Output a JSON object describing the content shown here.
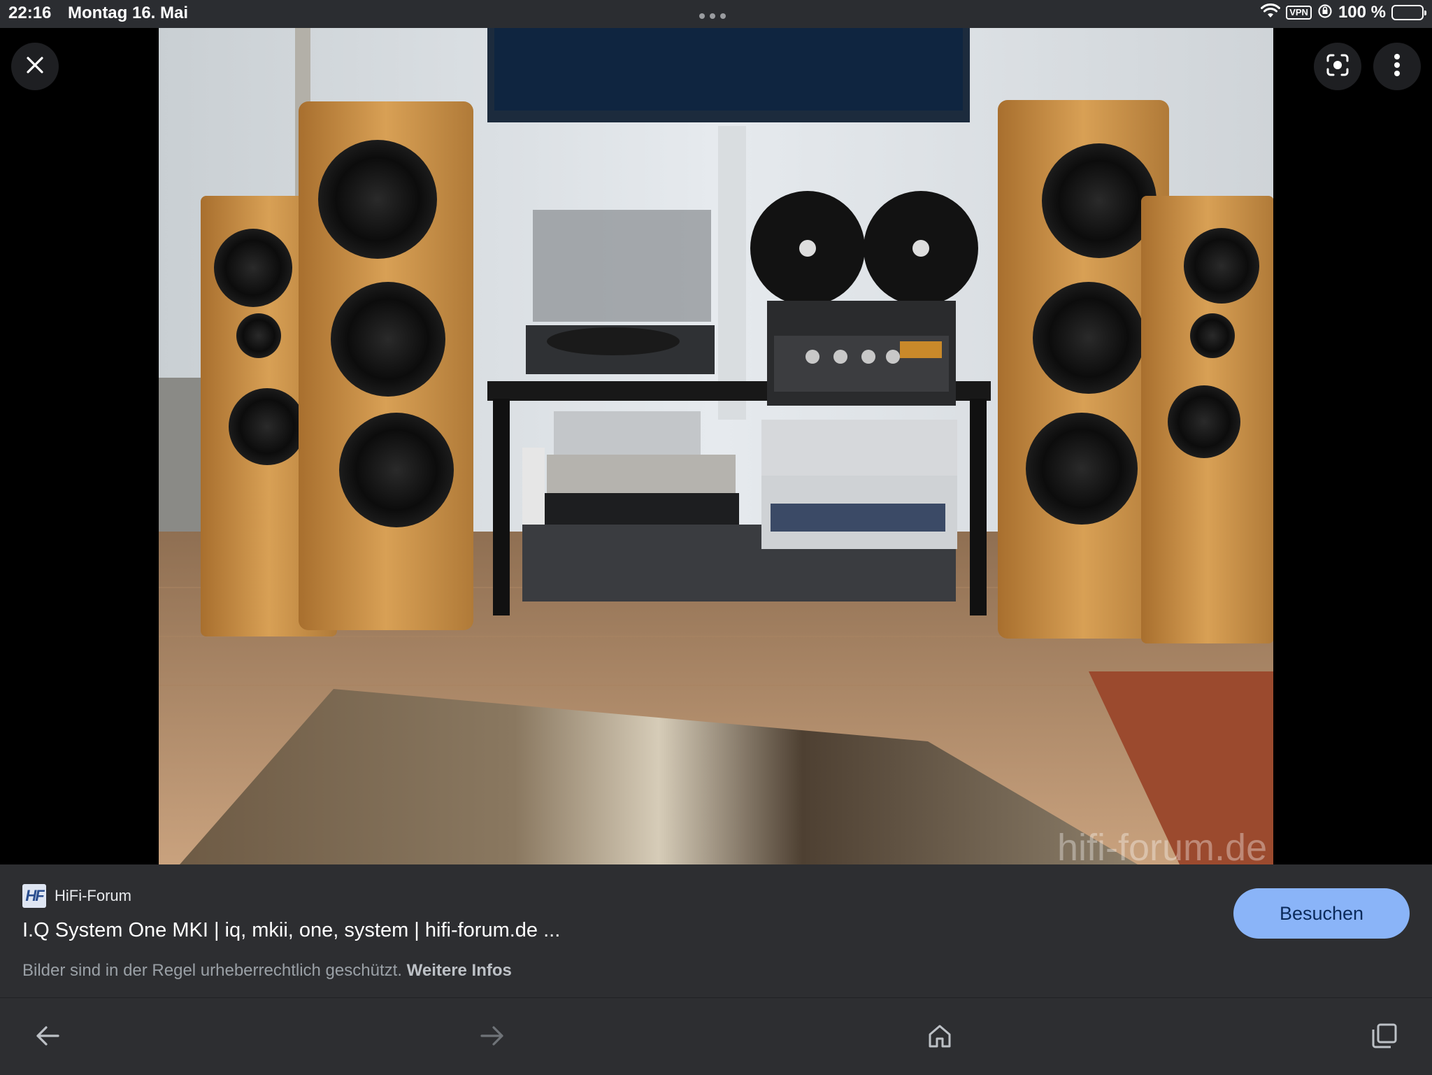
{
  "status_bar": {
    "time": "22:16",
    "date": "Montag 16. Mai",
    "vpn_label": "VPN",
    "battery_percent": "100 %",
    "battery_level": 1.0,
    "icons": [
      "wifi-icon",
      "vpn-icon",
      "orientation-lock-icon",
      "battery-icon"
    ]
  },
  "viewer": {
    "watermark": "hifi-forum.de",
    "buttons": [
      "close-icon",
      "google-lens-icon",
      "more-vert-icon"
    ]
  },
  "info": {
    "site_name": "HiFi-Forum",
    "site_logo_text": "HF",
    "title": "I.Q System One MKI | iq, mkii, one, system | hifi-forum.de ...",
    "visit_label": "Besuchen",
    "notice_text": "Bilder sind in der Regel urheberrechtlich geschützt.",
    "notice_link": "Weitere Infos"
  },
  "nav": {
    "icons": [
      "back-arrow-icon",
      "forward-arrow-icon",
      "home-icon",
      "tabs-icon"
    ]
  },
  "colors": {
    "panel_bg": "#2d2e31",
    "status_bg": "#2b2d31",
    "accent": "#8ab4f8"
  }
}
